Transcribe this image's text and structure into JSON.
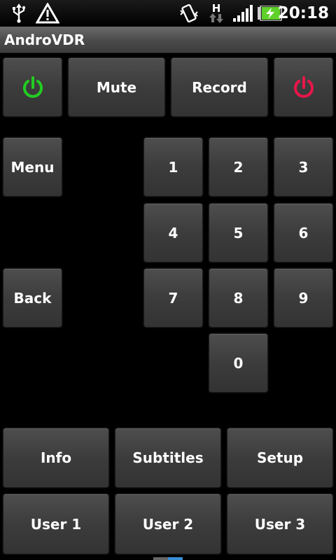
{
  "status_bar": {
    "time": "20:18",
    "network_type": "H",
    "icons": [
      "usb-icon",
      "warning-icon",
      "vibrate-icon",
      "data-transfer-icon",
      "signal-icon",
      "battery-charging-icon"
    ],
    "battery_color": "#5fd12a"
  },
  "app": {
    "title": "AndroVDR"
  },
  "top_row": {
    "mute_label": "Mute",
    "record_label": "Record",
    "power_on_color": "#22cc22",
    "power_off_color": "#e8164a"
  },
  "menu_label": "Menu",
  "back_label": "Back",
  "numpad": [
    "1",
    "2",
    "3",
    "4",
    "5",
    "6",
    "7",
    "8",
    "9",
    "0"
  ],
  "bottom_rows": {
    "info_label": "Info",
    "subtitles_label": "Subtitles",
    "setup_label": "Setup",
    "user1_label": "User 1",
    "user2_label": "User 2",
    "user3_label": "User 3"
  },
  "colors": {
    "button_text": "#ffffff",
    "background": "#000000"
  }
}
